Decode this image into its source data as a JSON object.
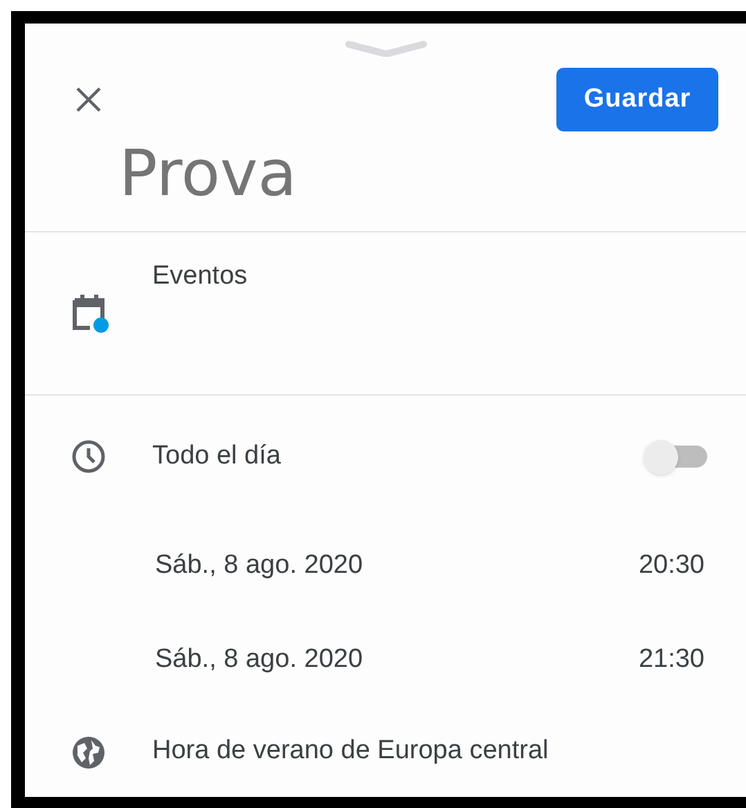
{
  "header": {
    "save_button": "Guardar"
  },
  "title": {
    "value": "Prova"
  },
  "calendar": {
    "label": "Eventos",
    "color": "#039be5"
  },
  "all_day": {
    "label": "Todo el día",
    "on": false
  },
  "start": {
    "date": "Sáb., 8 ago. 2020",
    "time": "20:30"
  },
  "end": {
    "date": "Sáb., 8 ago. 2020",
    "time": "21:30"
  },
  "timezone": {
    "label": "Hora de verano de Europa central"
  }
}
